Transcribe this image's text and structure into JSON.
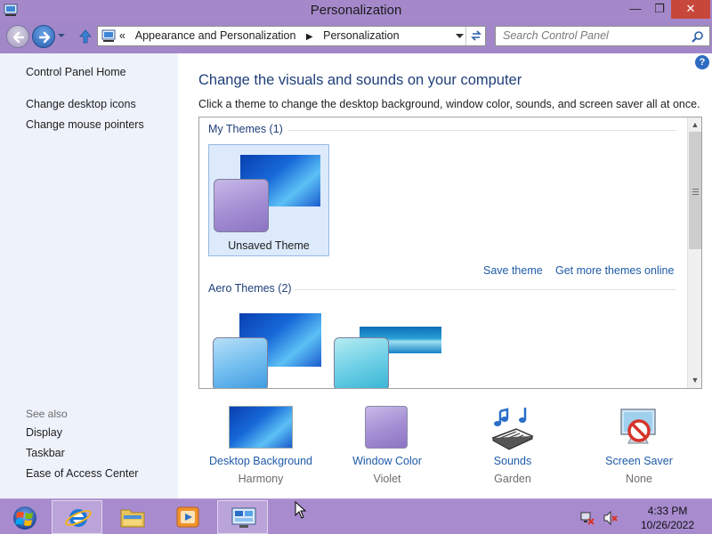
{
  "window": {
    "title": "Personalization",
    "minimize": "—",
    "maximize": "❐",
    "close": "✕"
  },
  "address": {
    "overflow": "«",
    "crumbs": [
      "Appearance and Personalization",
      "Personalization"
    ],
    "search_placeholder": "Search Control Panel"
  },
  "left_pane": {
    "home": "Control Panel Home",
    "links": [
      "Change desktop icons",
      "Change mouse pointers"
    ],
    "see_also_label": "See also",
    "see_also": [
      "Display",
      "Taskbar",
      "Ease of Access Center"
    ]
  },
  "main": {
    "heading": "Change the visuals and sounds on your computer",
    "instructions": "Click a theme to change the desktop background, window color, sounds, and screen saver all at once.",
    "help": "?",
    "my_themes_label": "My Themes (1)",
    "my_themes": [
      {
        "name": "Unsaved Theme",
        "swatch": "violet"
      }
    ],
    "save_theme": "Save theme",
    "get_more": "Get more themes online",
    "aero_label": "Aero Themes (2)",
    "aero_themes": [
      {
        "swatch": "blue"
      },
      {
        "swatch": "aqua"
      }
    ]
  },
  "settings": [
    {
      "label": "Desktop Background",
      "value": "Harmony",
      "icon": "desktop-background-icon"
    },
    {
      "label": "Window Color",
      "value": "Violet",
      "icon": "window-color-icon"
    },
    {
      "label": "Sounds",
      "value": "Garden",
      "icon": "sounds-icon"
    },
    {
      "label": "Screen Saver",
      "value": "None",
      "icon": "screen-saver-icon"
    }
  ],
  "taskbar": {
    "time": "4:33 PM",
    "date": "10/26/2022",
    "apps": [
      "internet-explorer-icon",
      "file-explorer-icon",
      "media-player-icon",
      "control-panel-icon"
    ]
  },
  "colors": {
    "accent": "#a287c8",
    "link": "#1e5ba8",
    "heading": "#1f3f7a",
    "close": "#c7473b"
  }
}
